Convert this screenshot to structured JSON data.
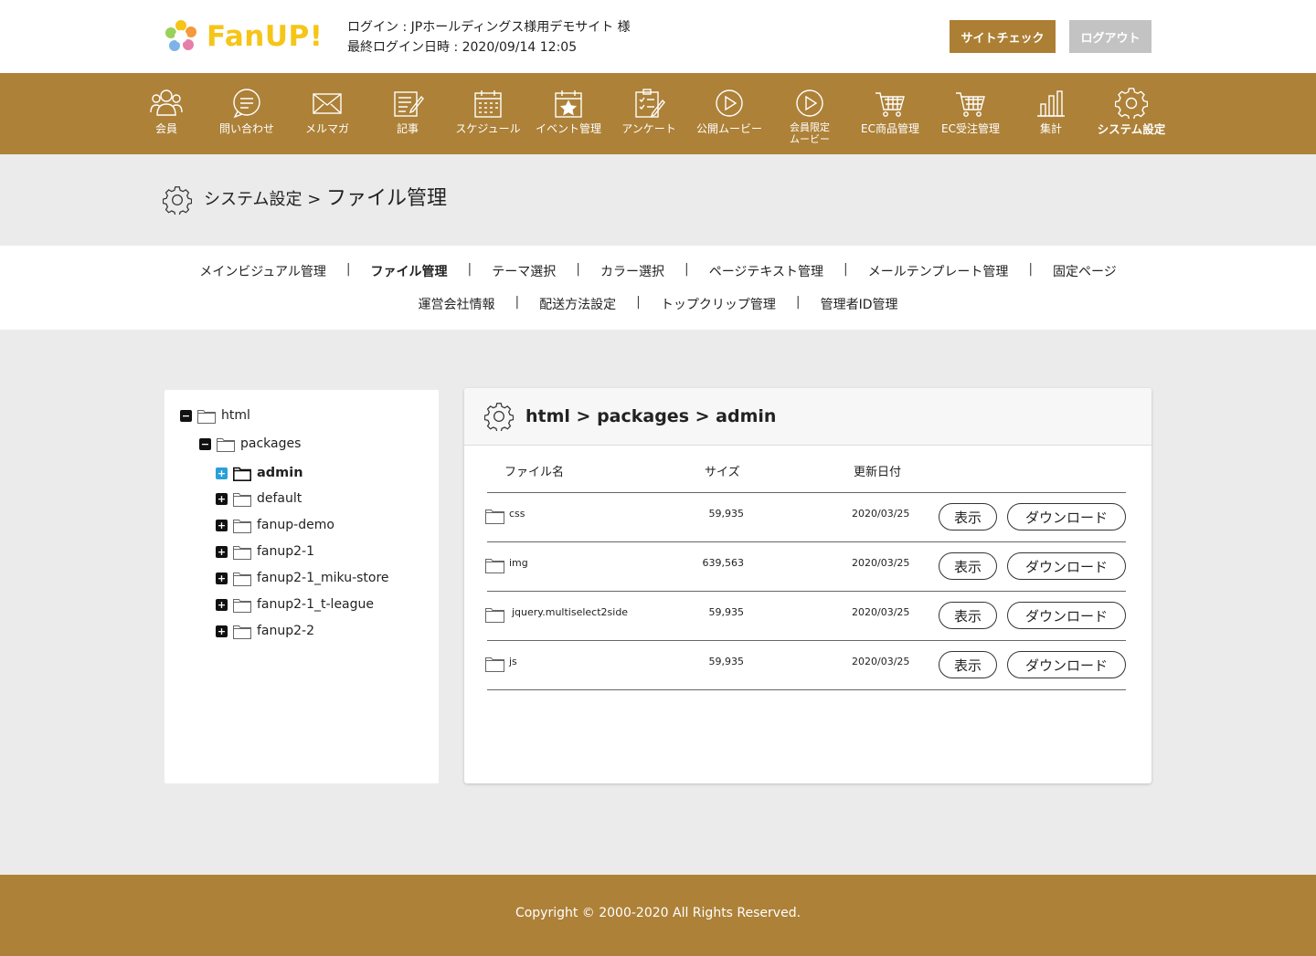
{
  "header": {
    "logo_text": "FanUP!",
    "login_line": "ログイン : JPホールディングス様用デモサイト 様",
    "last_login_line": "最終ログイン日時 : 2020/09/14 12:05",
    "site_check_label": "サイトチェック",
    "logout_label": "ログアウト"
  },
  "nav": {
    "items": [
      {
        "label": "会員",
        "icon": "members-icon"
      },
      {
        "label": "問い合わせ",
        "icon": "chat-icon"
      },
      {
        "label": "メルマガ",
        "icon": "mail-icon"
      },
      {
        "label": "記事",
        "icon": "article-icon"
      },
      {
        "label": "スケジュール",
        "icon": "calendar-icon"
      },
      {
        "label": "イベント管理",
        "icon": "event-icon"
      },
      {
        "label": "アンケート",
        "icon": "survey-icon"
      },
      {
        "label": "公開ムービー",
        "icon": "play-icon"
      },
      {
        "label": "会員限定",
        "label2": "ムービー",
        "icon": "play-icon"
      },
      {
        "label": "EC商品管理",
        "icon": "cart-icon"
      },
      {
        "label": "EC受注管理",
        "icon": "cart-icon"
      },
      {
        "label": "集計",
        "icon": "bar-chart-icon"
      },
      {
        "label": "システム設定",
        "icon": "gear-icon",
        "active": true
      }
    ]
  },
  "page_title": {
    "parent": "システム設定",
    "separator": ">",
    "current": "ファイル管理"
  },
  "submenu": {
    "row1": [
      "メインビジュアル管理",
      "ファイル管理",
      "テーマ選択",
      "カラー選択",
      "ページテキスト管理",
      "メールテンプレート管理",
      "固定ページ"
    ],
    "row2": [
      "運営会社情報",
      "配送方法設定",
      "トップクリップ管理",
      "管理者ID管理"
    ],
    "active": "ファイル管理",
    "separator": "|"
  },
  "tree": {
    "root": "html",
    "child": "packages",
    "items": [
      "admin",
      "default",
      "fanup-demo",
      "fanup2-1",
      "fanup2-1_miku-store",
      "fanup2-1_t-league",
      "fanup2-2"
    ],
    "selected": "admin",
    "collapse_symbol": "−",
    "expand_symbol": "+"
  },
  "files": {
    "path": "html > packages > admin",
    "columns": {
      "name": "ファイル名",
      "size": "サイズ",
      "date": "更新日付"
    },
    "show_label": "表示",
    "download_label": "ダウンロード",
    "rows": [
      {
        "name": "css",
        "size": "59,935",
        "date": "2020/03/25"
      },
      {
        "name": "img",
        "size": "639,563",
        "date": "2020/03/25"
      },
      {
        "name": "jquery.multiselect2side",
        "size": "59,935",
        "date": "2020/03/25"
      },
      {
        "name": "js",
        "size": "59,935",
        "date": "2020/03/25"
      }
    ]
  },
  "footer": {
    "copyright": "Copyright © 2000-2020 All Rights Reserved."
  },
  "colors": {
    "brand": "#ad8138",
    "button_gold": "#ac7f35",
    "button_grey": "#c3c3c3",
    "logo_yellow": "#f5c518",
    "tree_selected": "#2aa0d8"
  }
}
